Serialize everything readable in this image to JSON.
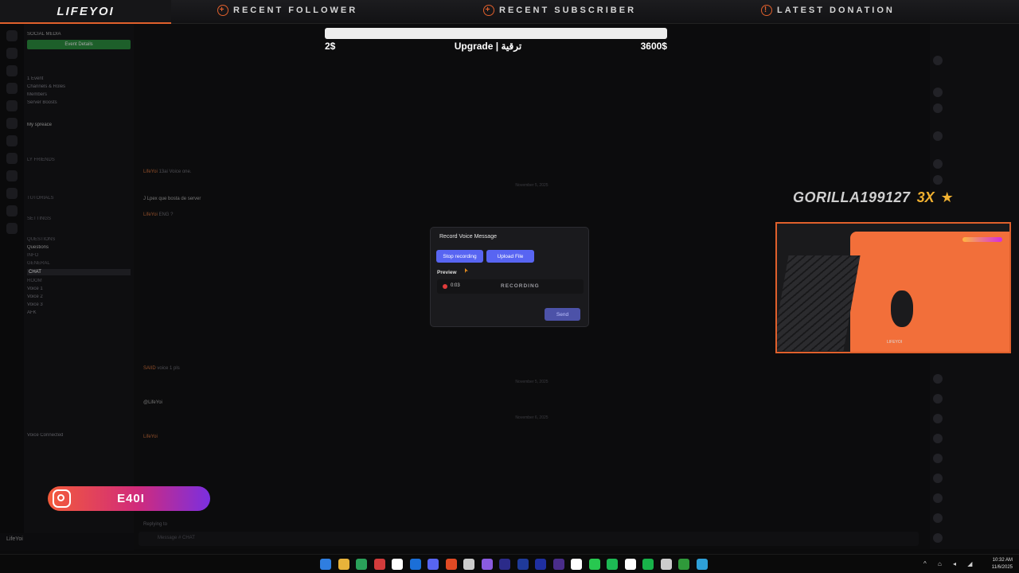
{
  "overlay": {
    "logo": "LIFEYOI",
    "top_items": [
      {
        "label": "RECENT FOLLOWER",
        "icon": "plus-icon"
      },
      {
        "label": "RECENT SUBSCRIBER",
        "icon": "plus-icon"
      },
      {
        "label": "LATEST DONATION",
        "icon": "info-icon"
      }
    ],
    "goal": {
      "start": "2$",
      "title": "Upgrade | ترقية",
      "end": "3600$",
      "progress_fraction": 0.0
    },
    "gift": {
      "name": "GORILLA199127",
      "multiplier": "3X"
    },
    "cam_tag": "LIFEYOI",
    "instagram": {
      "handle": "E40I"
    }
  },
  "sidebar": {
    "server": "SOCIAL MEDIA",
    "event_button": "Event Details",
    "items": [
      "1 Event",
      "Channels & Roles",
      "Members",
      "Server Boosts"
    ],
    "sections": [
      "My spreace",
      "LY FRIENDS",
      "Tutorials",
      "Settings",
      "Questions",
      "Info",
      "General",
      "Room"
    ],
    "channels": [
      "Questions",
      "CHAT",
      "Voice 1",
      "Voice 2",
      "Voice 3",
      "AFK"
    ],
    "user": {
      "name": "LifeYoi"
    },
    "voice_connected": "Voice Connected"
  },
  "chat": {
    "messages": [
      {
        "user": "LifeYoi",
        "text": "13ai Voice one."
      },
      {
        "user": "J Lpex",
        "text": "que bosta de server"
      },
      {
        "user": "LifeYoi",
        "text": "ENG ?"
      },
      {
        "user": "SAIID",
        "text": "voice 1 pls"
      },
      {
        "user": "",
        "text": "@LifeYoi"
      },
      {
        "user": "LifeYoi",
        "text": ""
      }
    ],
    "dates": [
      "November 5, 2025",
      "November 5, 2025",
      "November 6, 2025"
    ],
    "reply_to": "Replying to",
    "composer_placeholder": "Message # CHAT"
  },
  "modal": {
    "title": "Record Voice Message",
    "stop_label": "Stop recording",
    "upload_label": "Upload File",
    "preview_label": "Preview",
    "time": "0:03",
    "status": "RECORDING",
    "send_label": "Send"
  },
  "taskbar": {
    "time": "10:32 AM",
    "date": "11/6/2025",
    "icon_colors": [
      "#2f7ee0",
      "#e8b33a",
      "#2aa15a",
      "#d23b3b",
      "#ffffff",
      "#1b6fd8",
      "#5865f2",
      "#e24a24",
      "#cccccc",
      "#8a5be0",
      "#2b2b8a",
      "#1f3a9a",
      "#1f2fa0",
      "#4a2d8a",
      "#ffffff",
      "#28c850",
      "#1db954",
      "#ffffff",
      "#18b24a",
      "#cccccc",
      "#2f9a3a",
      "#2ea0d8"
    ]
  },
  "colors": {
    "accent": "#e0602c",
    "discord_blue": "#5865f2",
    "record_red": "#e03b3b"
  }
}
